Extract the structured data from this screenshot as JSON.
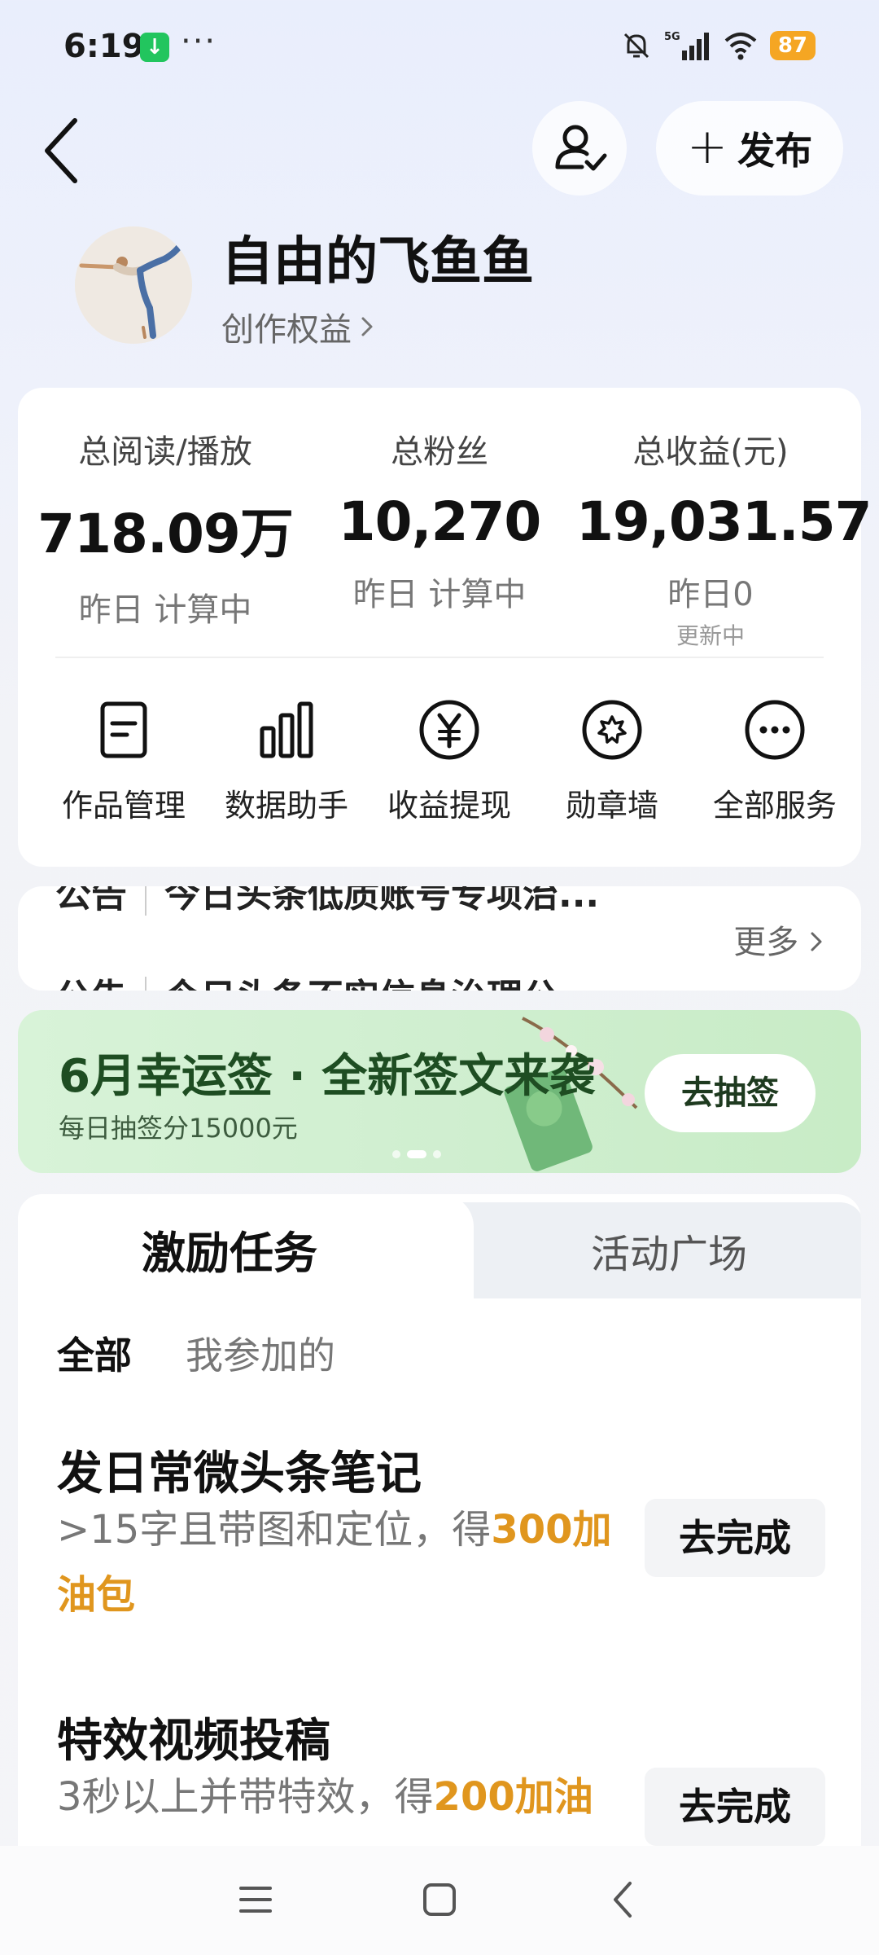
{
  "status_bar": {
    "time": "6:19",
    "download_icon": "download-icon",
    "more_dots": "···",
    "network": "5G",
    "battery": "87"
  },
  "header": {
    "publish_label": "发布",
    "follow_icon": "user-follow-icon"
  },
  "profile": {
    "username": "自由的飞鱼鱼",
    "rights_label": "创作权益"
  },
  "stats": [
    {
      "label": "总阅读/播放",
      "value": "718.09万",
      "sub": "昨日 计算中",
      "sub2": ""
    },
    {
      "label": "总粉丝",
      "value": "10,270",
      "sub": "昨日 计算中",
      "sub2": ""
    },
    {
      "label": "总收益(元)",
      "value": "19,031.57",
      "sub": "昨日0",
      "sub2": "更新中"
    }
  ],
  "services": [
    {
      "label": "作品管理",
      "icon": "document-icon"
    },
    {
      "label": "数据助手",
      "icon": "bar-chart-icon"
    },
    {
      "label": "收益提现",
      "icon": "yen-icon"
    },
    {
      "label": "勋章墙",
      "icon": "medal-icon"
    },
    {
      "label": "全部服务",
      "icon": "more-icon"
    }
  ],
  "notices": {
    "tag": "公告",
    "items": [
      "今日头条低质账号专项治...",
      "今日头条不实信息治理公"
    ],
    "more_label": "更多"
  },
  "banner": {
    "title": "6月幸运签 · 全新签文来袭",
    "subtitle": "每日抽签分15000元",
    "button": "去抽签"
  },
  "tasks": {
    "tabs": [
      "激励任务",
      "活动广场"
    ],
    "filters": [
      "全部",
      "我参加的"
    ],
    "items": [
      {
        "title": "发日常微头条笔记",
        "desc_prefix": ">15字且带图和定位，得",
        "desc_highlight": "300加油包",
        "button": "去完成"
      },
      {
        "title": "特效视频投稿",
        "desc_prefix": "3秒以上并带特效，得",
        "desc_highlight": "200加油",
        "button": "去完成"
      }
    ]
  },
  "colors": {
    "accent_orange": "#e0961e",
    "banner_green": "#1e4d22",
    "battery": "#f5a623"
  }
}
